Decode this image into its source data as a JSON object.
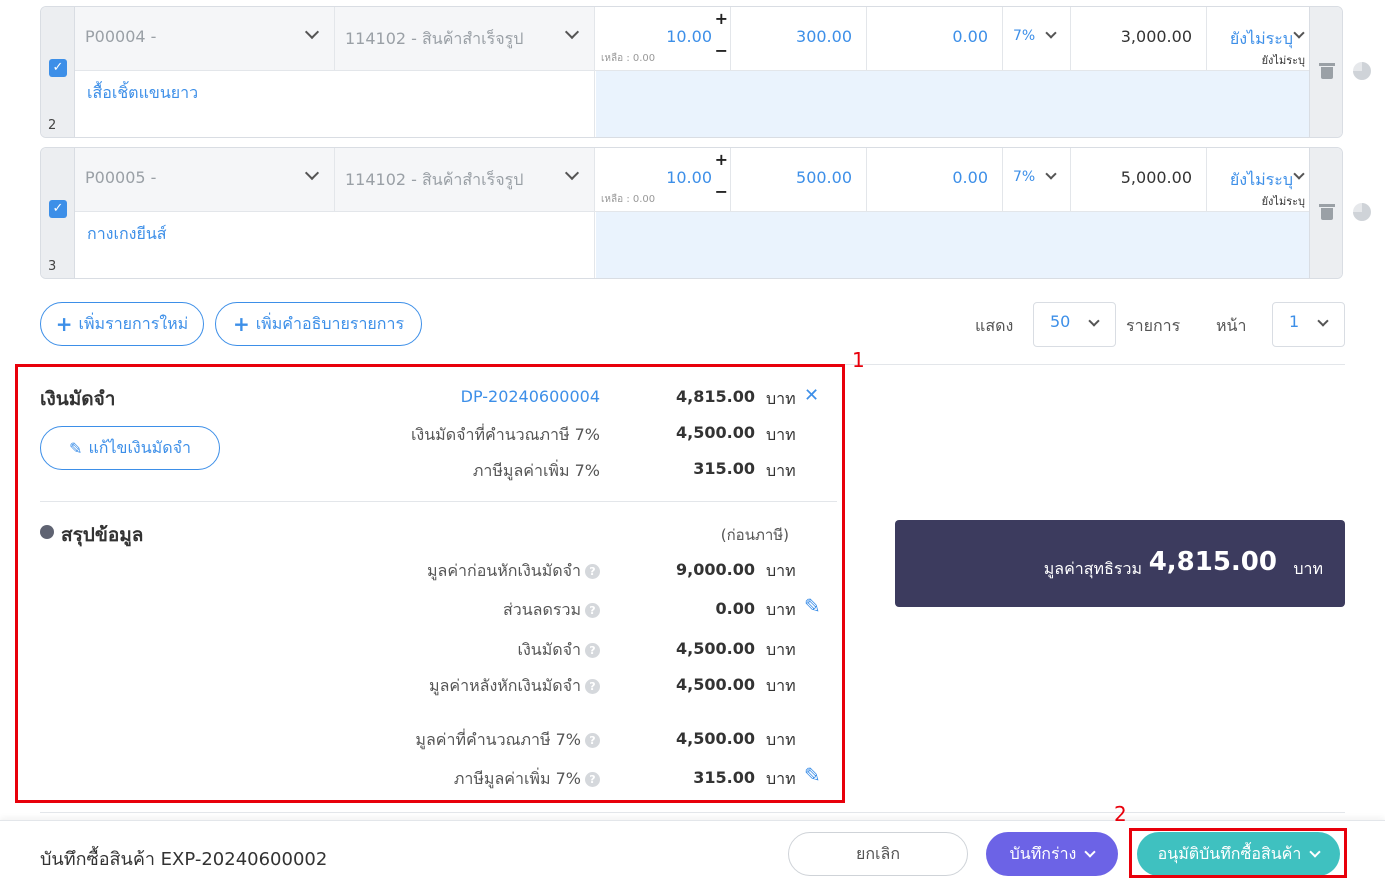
{
  "rows": [
    {
      "index": "2",
      "product_code": "P00004 -",
      "account": "114102 - สินค้าสำเร็จรูป",
      "quantity": "10.00",
      "remaining": "เหลือ : 0.00",
      "unit_price": "300.00",
      "discount": "0.00",
      "vat": "7%",
      "amount": "3,000.00",
      "status": "ยังไม่ระบุ",
      "status_sub": "ยังไม่ระบุ",
      "description": "เสื้อเชิ้ตแขนยาว"
    },
    {
      "index": "3",
      "product_code": "P00005 -",
      "account": "114102 - สินค้าสำเร็จรูป",
      "quantity": "10.00",
      "remaining": "เหลือ : 0.00",
      "unit_price": "500.00",
      "discount": "0.00",
      "vat": "7%",
      "amount": "5,000.00",
      "status": "ยังไม่ระบุ",
      "status_sub": "ยังไม่ระบุ",
      "description": "กางเกงยีนส์"
    }
  ],
  "actions": {
    "add_item": "เพิ่มรายการใหม่",
    "add_description": "เพิ่มคำอธิบายรายการ"
  },
  "pagination": {
    "show_label": "แสดง",
    "per_page": "50",
    "items_label": "รายการ",
    "page_label": "หน้า",
    "page": "1"
  },
  "deposit": {
    "title": "เงินมัดจำ",
    "edit_button": "แก้ไขเงินมัดจำ",
    "doc_no": "DP-20240600004",
    "doc_amount": "4,815.00",
    "taxable_label": "เงินมัดจำที่คำนวณภาษี 7%",
    "taxable_amount": "4,500.00",
    "vat_label": "ภาษีมูลค่าเพิ่ม 7%",
    "vat_amount": "315.00",
    "unit": "บาท"
  },
  "summary": {
    "title": "สรุปข้อมูล",
    "pre_tax_note": "(ก่อนภาษี)",
    "lines": [
      {
        "label": "มูลค่าก่อนหักเงินมัดจำ",
        "value": "9,000.00"
      },
      {
        "label": "ส่วนลดรวม",
        "value": "0.00"
      },
      {
        "label": "เงินมัดจำ",
        "value": "4,500.00"
      },
      {
        "label": "มูลค่าหลังหักเงินมัดจำ",
        "value": "4,500.00"
      },
      {
        "label": "มูลค่าที่คำนวณภาษี 7%",
        "value": "4,500.00"
      },
      {
        "label": "ภาษีมูลค่าเพิ่ม 7%",
        "value": "315.00"
      }
    ],
    "unit": "บาท"
  },
  "net_total": {
    "label": "มูลค่าสุทธิรวม",
    "value": "4,815.00",
    "unit": "บาท"
  },
  "annotations": {
    "box1": "1",
    "box2": "2"
  },
  "footer": {
    "doc_title": "บันทึกซื้อสินค้า EXP-20240600002",
    "cancel": "ยกเลิก",
    "save_draft": "บันทึกร่าง",
    "approve": "อนุมัติบันทึกซื้อสินค้า"
  },
  "colors": {
    "accent": "#3d8fe8",
    "draft_button": "#6c63e6",
    "approve_button": "#3fc1c0",
    "net_panel": "#3c3b5e",
    "annotation": "#e8000b"
  }
}
